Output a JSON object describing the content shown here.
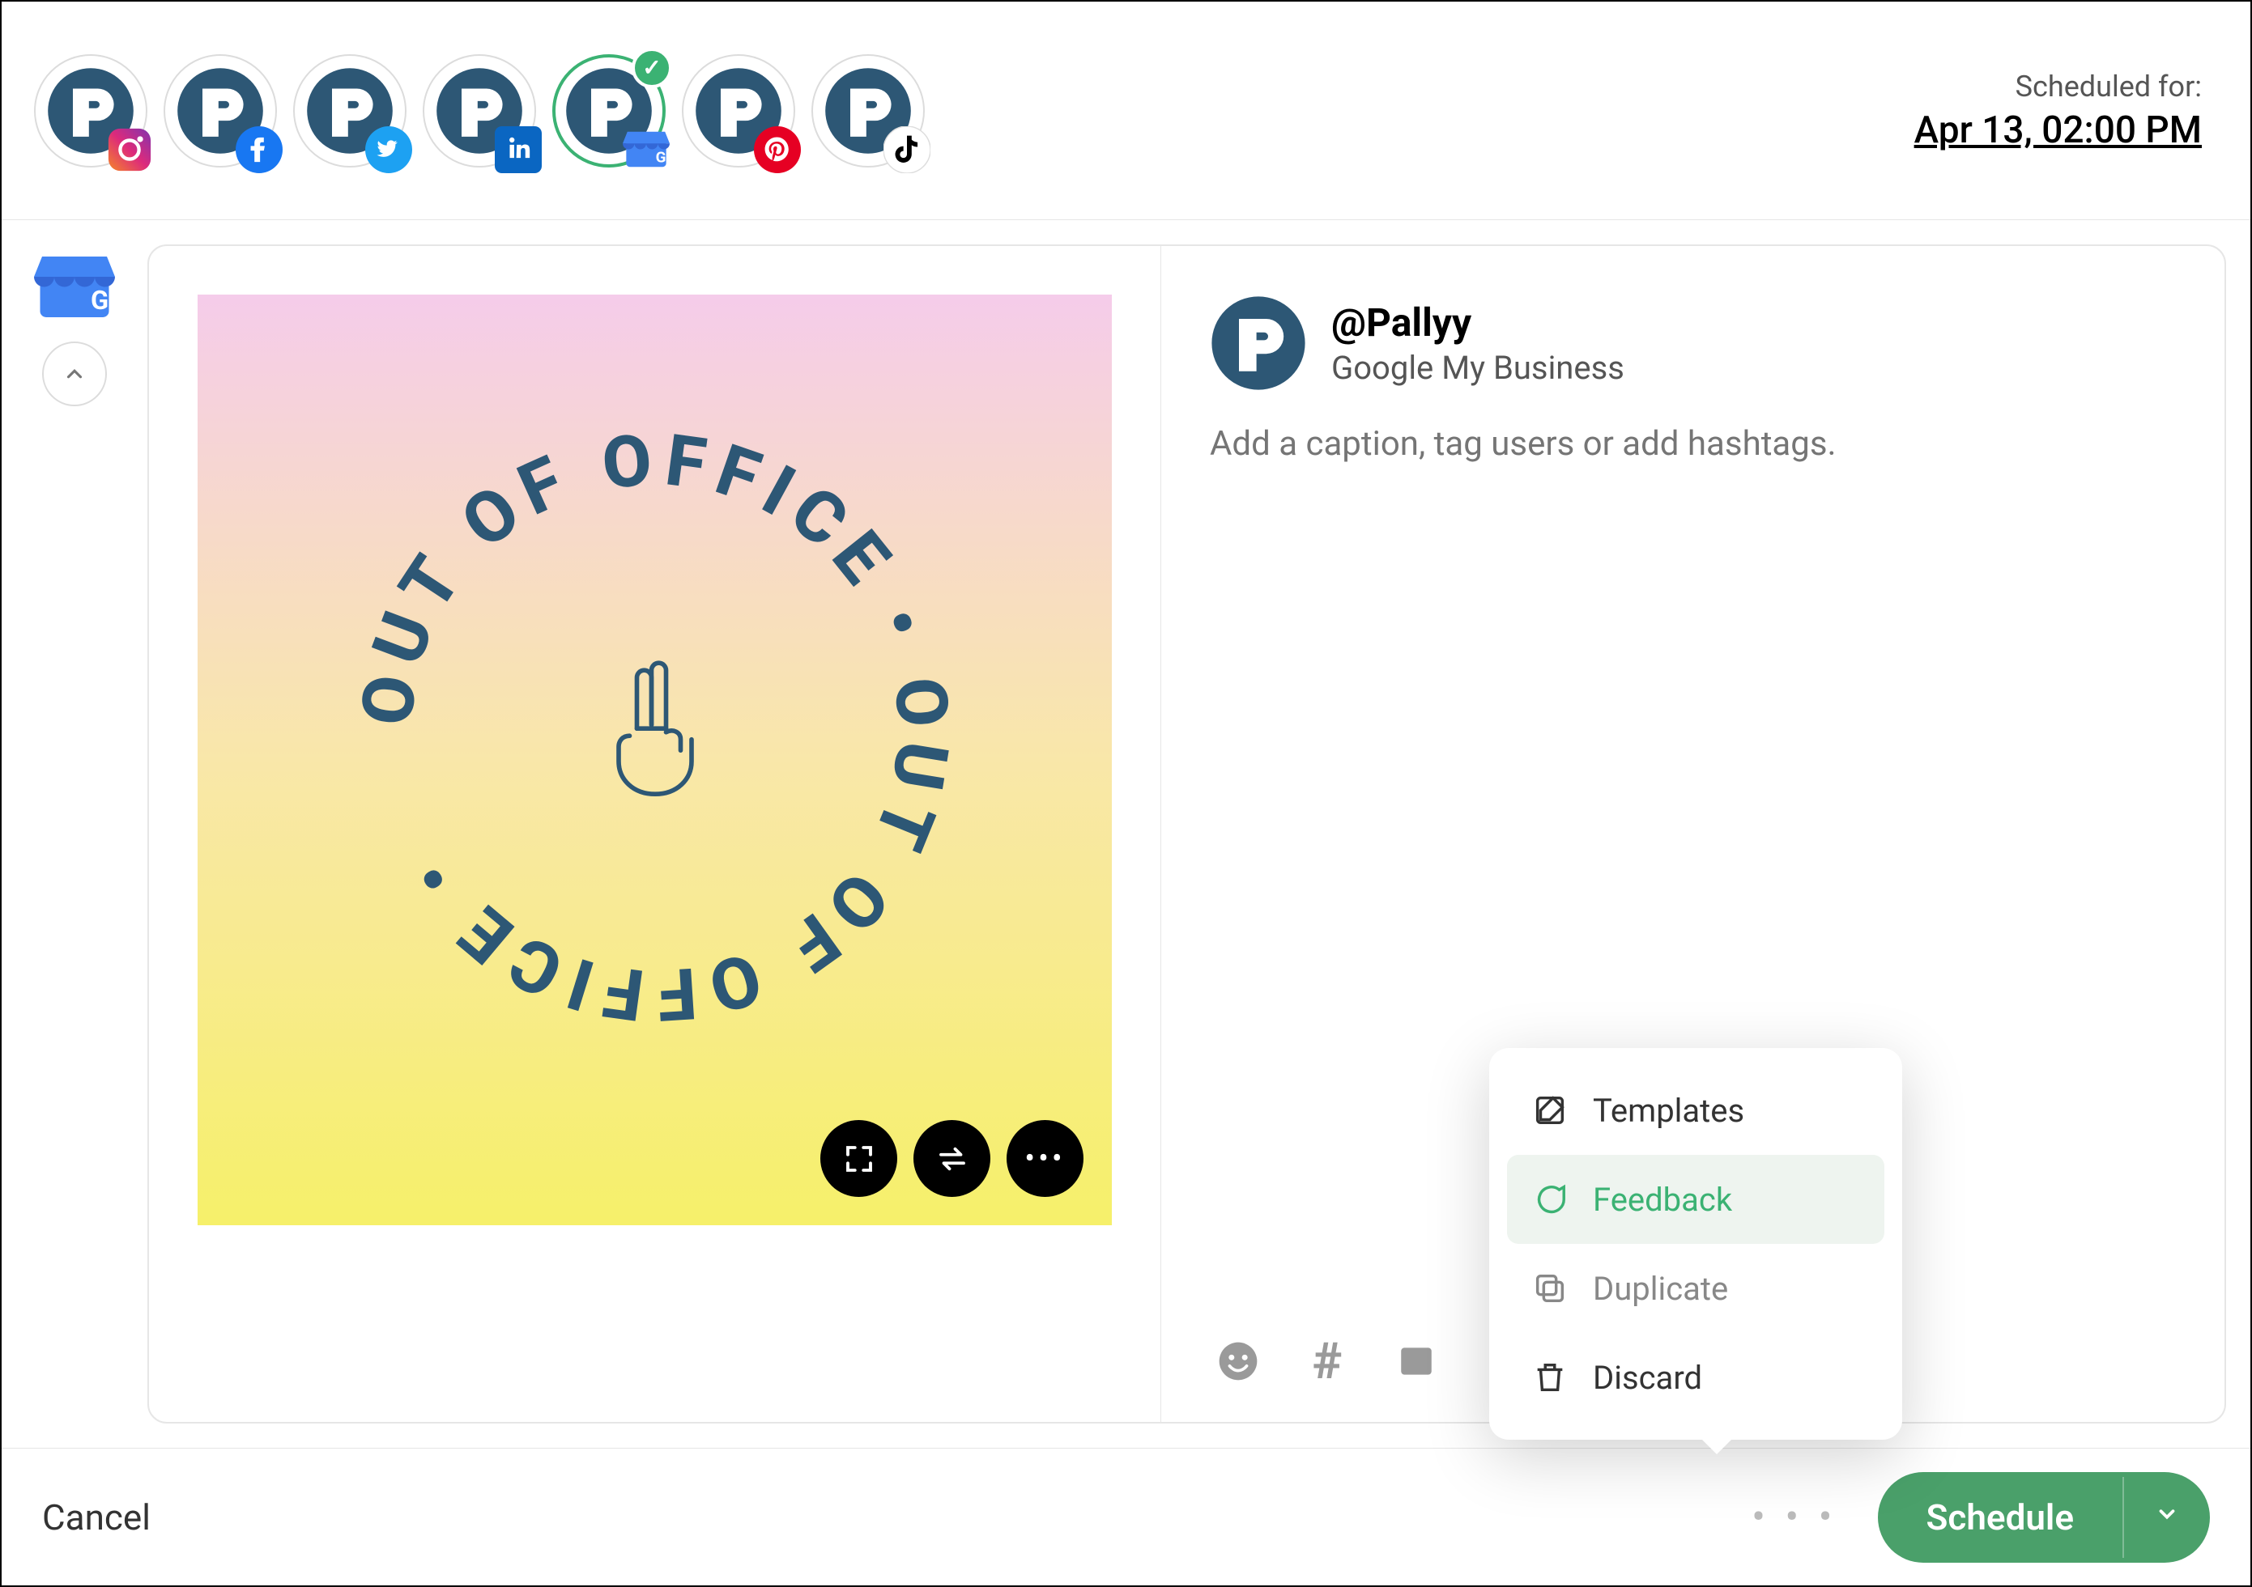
{
  "header": {
    "scheduled_label": "Scheduled for:",
    "scheduled_datetime": "Apr 13, 02:00 PM"
  },
  "accounts": [
    {
      "network": "instagram",
      "selected": false
    },
    {
      "network": "facebook",
      "selected": false
    },
    {
      "network": "twitter",
      "selected": false
    },
    {
      "network": "linkedin",
      "selected": false
    },
    {
      "network": "google-my-business",
      "selected": true
    },
    {
      "network": "pinterest",
      "selected": false
    },
    {
      "network": "tiktok",
      "selected": false
    }
  ],
  "compose": {
    "account_handle": "@Pallyy",
    "account_platform": "Google My Business",
    "caption_placeholder": "Add a caption, tag users or add hashtags."
  },
  "preview": {
    "graphic_text": "OUT OF OFFICE • OUT OF OFFICE •"
  },
  "popup": {
    "items": [
      {
        "icon": "edit-icon",
        "label": "Templates",
        "highlight": false
      },
      {
        "icon": "chat-icon",
        "label": "Feedback",
        "highlight": true
      },
      {
        "icon": "duplicate-icon",
        "label": "Duplicate",
        "highlight": false
      },
      {
        "icon": "trash-icon",
        "label": "Discard",
        "highlight": false
      }
    ]
  },
  "footer": {
    "cancel_label": "Cancel",
    "schedule_label": "Schedule"
  }
}
